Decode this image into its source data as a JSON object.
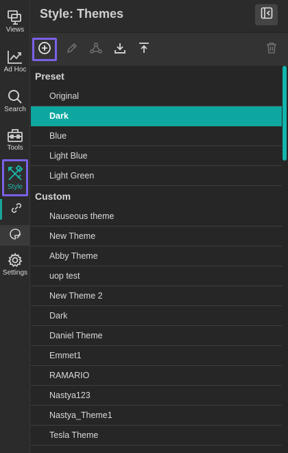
{
  "sidebar": {
    "items": [
      {
        "label": "Views",
        "icon": "views-icon"
      },
      {
        "label": "Ad Hoc",
        "icon": "adhoc-chart-icon"
      },
      {
        "label": "Search",
        "icon": "search-icon"
      },
      {
        "label": "Tools",
        "icon": "toolbox-icon"
      },
      {
        "label": "Style",
        "icon": "style-icon"
      },
      {
        "label": "Settings",
        "icon": "gear-icon"
      }
    ],
    "sub_items": [
      {
        "icon": "style-link-icon"
      },
      {
        "icon": "palette-brush-icon"
      }
    ]
  },
  "header": {
    "title": "Style: Themes",
    "collapse_icon": "collapse-panel-icon"
  },
  "toolbar": {
    "tools": [
      {
        "name": "add-theme",
        "icon": "plus-circle-icon"
      },
      {
        "name": "edit-theme",
        "icon": "pencil-icon"
      },
      {
        "name": "share-theme",
        "icon": "share-nodes-icon"
      },
      {
        "name": "download-theme",
        "icon": "download-icon"
      },
      {
        "name": "upload-theme",
        "icon": "upload-icon"
      },
      {
        "name": "delete-theme",
        "icon": "trash-icon"
      }
    ]
  },
  "preset": {
    "heading": "Preset",
    "items": [
      "Original",
      "Dark",
      "Blue",
      "Light Blue",
      "Light Green"
    ],
    "selected": "Dark"
  },
  "custom": {
    "heading": "Custom",
    "items": [
      "Nauseous theme",
      "New Theme",
      "Abby Theme",
      "uop test",
      "New Theme 2",
      "Dark",
      "Daniel Theme",
      "Emmet1",
      "RAMARIO",
      "Nastya123",
      "Nastya_Theme1",
      "Tesla Theme"
    ]
  },
  "colors": {
    "accent": "#0da7a0",
    "highlight_outline": "#7b61e8",
    "background": "#262626",
    "rail": "#2b2b2b"
  }
}
